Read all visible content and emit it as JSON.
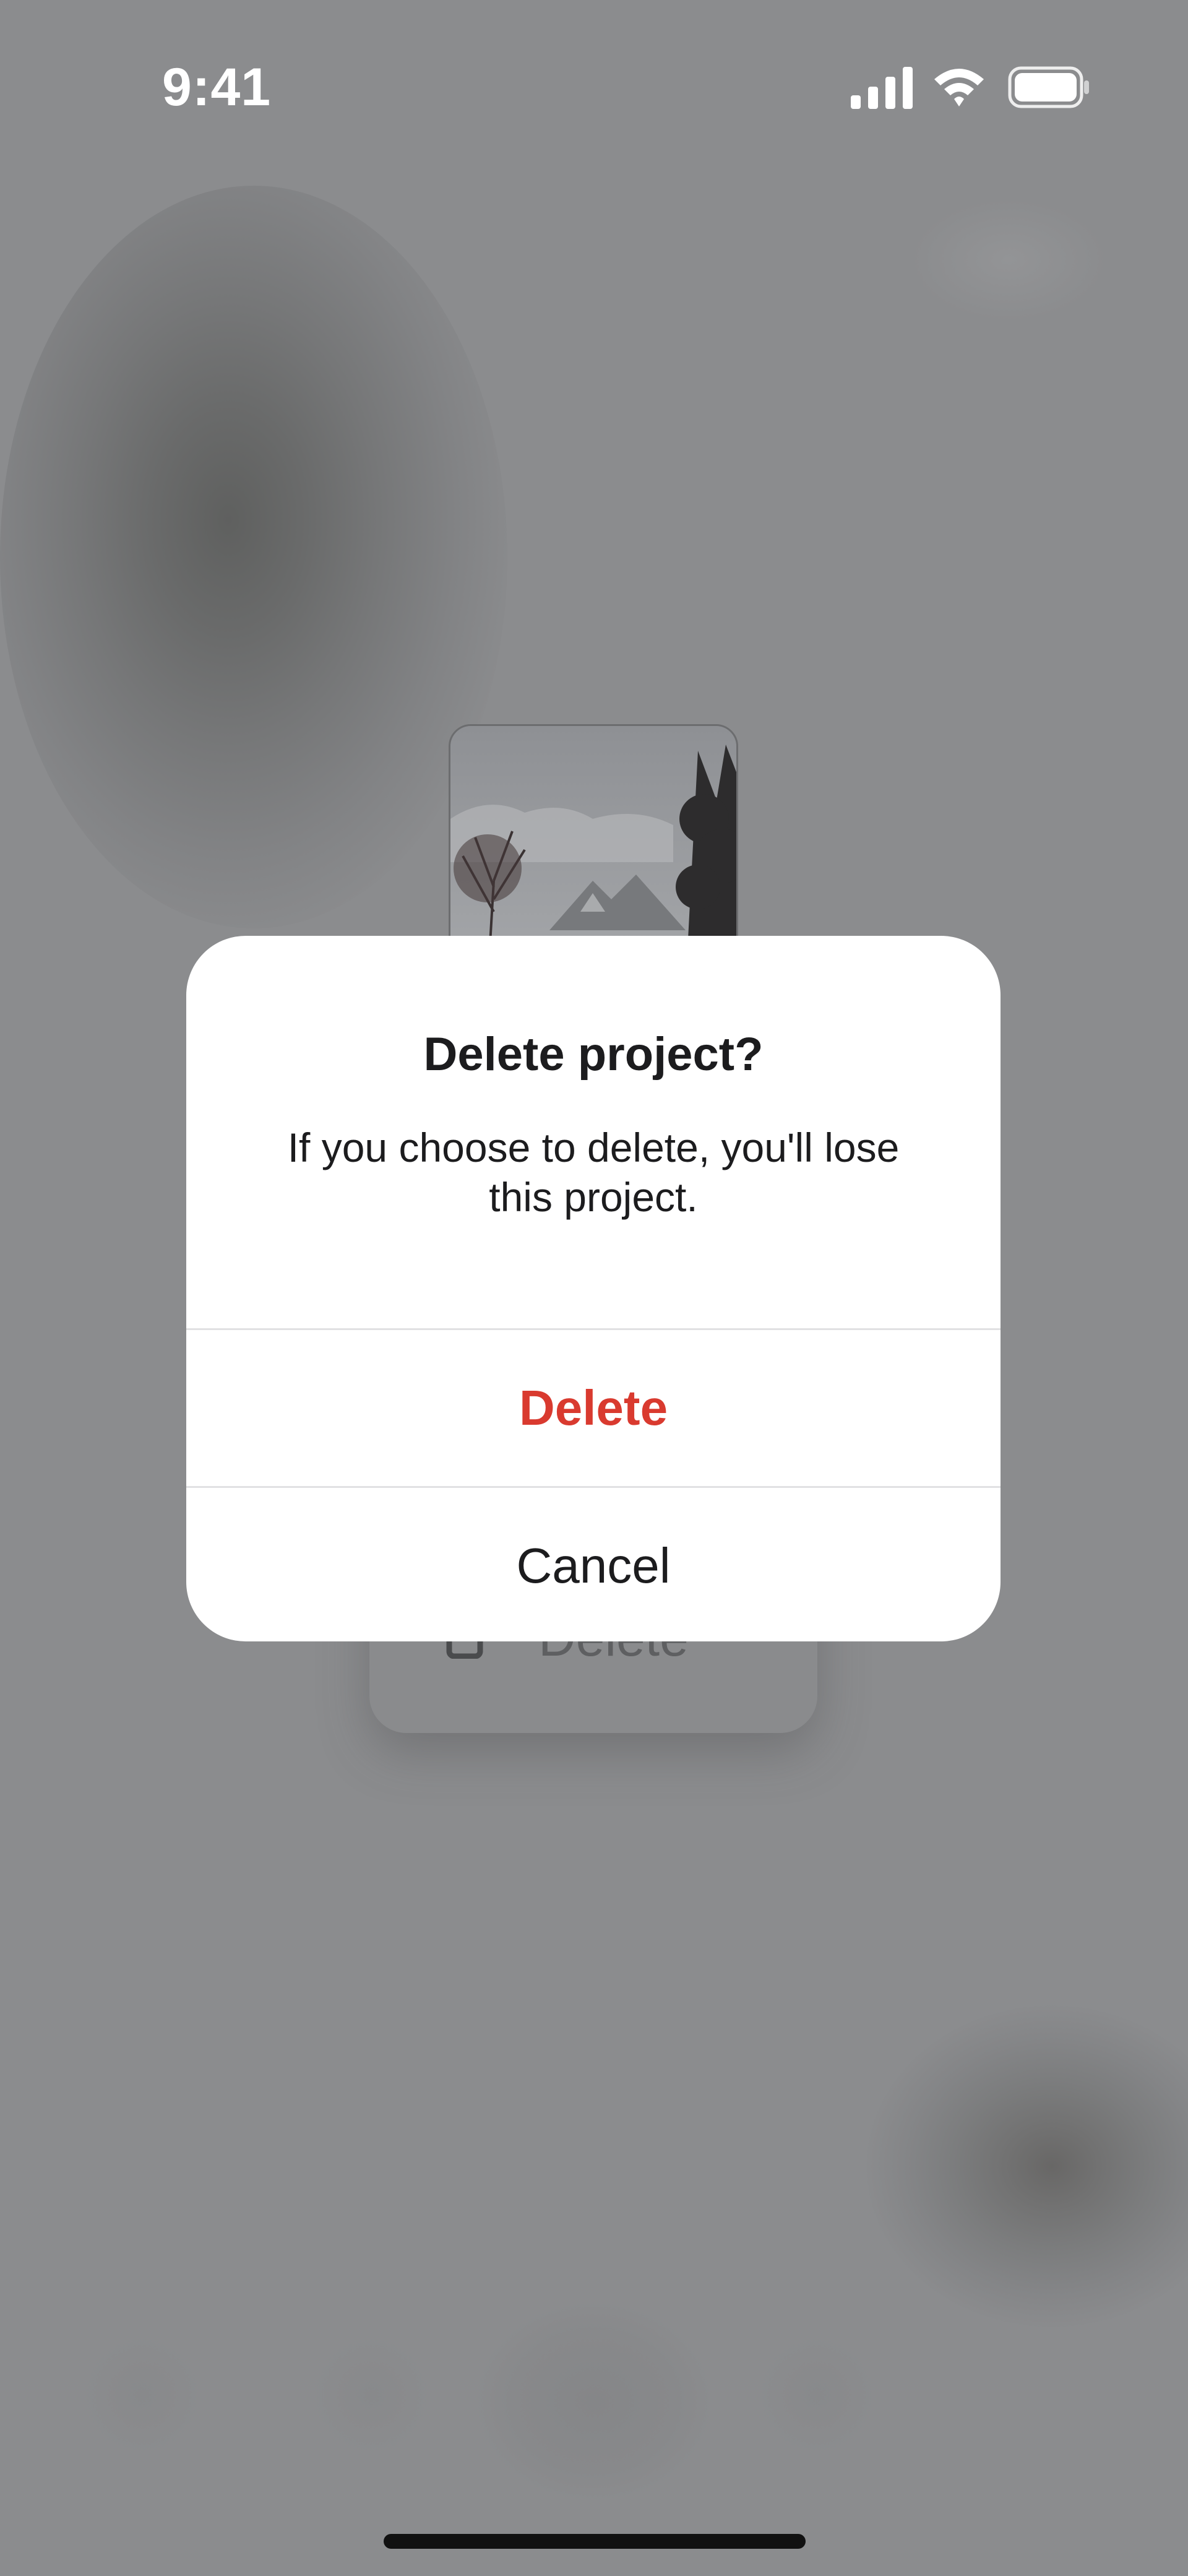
{
  "status_bar": {
    "time": "9:41",
    "icons": [
      "cellular-signal-icon",
      "wifi-icon",
      "battery-icon"
    ]
  },
  "background": {
    "project_thumbnail": "landscape-photo",
    "context_menu": {
      "item_label": "Delete",
      "item_icon": "trash-icon"
    }
  },
  "alert": {
    "title": "Delete project?",
    "message": "If you choose to delete, you'll lose this project.",
    "delete_label": "Delete",
    "cancel_label": "Cancel"
  },
  "colors": {
    "scrim": "#8b8c8e",
    "destructive": "#d93a2f",
    "alert_background": "#ffffff"
  }
}
